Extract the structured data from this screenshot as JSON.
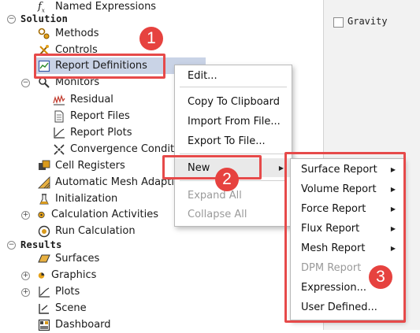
{
  "tree": {
    "named_expressions": "Named Expressions",
    "solution_header": "Solution",
    "methods": "Methods",
    "controls": "Controls",
    "report_definitions": "Report Definitions",
    "monitors": "Monitors",
    "residual": "Residual",
    "report_files": "Report Files",
    "report_plots": "Report Plots",
    "convergence_conditions": "Convergence Conditi",
    "cell_registers": "Cell Registers",
    "automatic_mesh_adaption": "Automatic Mesh Adaptio",
    "initialization": "Initialization",
    "calculation_activities": "Calculation Activities",
    "run_calculation": "Run Calculation",
    "results_header": "Results",
    "surfaces": "Surfaces",
    "graphics": "Graphics",
    "plots": "Plots",
    "scene": "Scene",
    "dashboard": "Dashboard"
  },
  "context_menu": {
    "edit": "Edit...",
    "copy_to_clipboard": "Copy To Clipboard",
    "import_from_file": "Import From File...",
    "export_to_file": "Export To File...",
    "new": "New",
    "expand_all": "Expand All",
    "collapse_all": "Collapse All"
  },
  "submenu": {
    "surface_report": "Surface Report",
    "volume_report": "Volume Report",
    "force_report": "Force Report",
    "flux_report": "Flux Report",
    "mesh_report": "Mesh Report",
    "dpm_report": "DPM Report",
    "expression": "Expression...",
    "user_defined": "User Defined..."
  },
  "right_panel": {
    "gravity_label": "Gravity"
  },
  "annotations": {
    "step1": "1",
    "step2": "2",
    "step3": "3"
  },
  "colors": {
    "annotation_red": "#e64a4a",
    "selection": "#c9d3e6"
  }
}
